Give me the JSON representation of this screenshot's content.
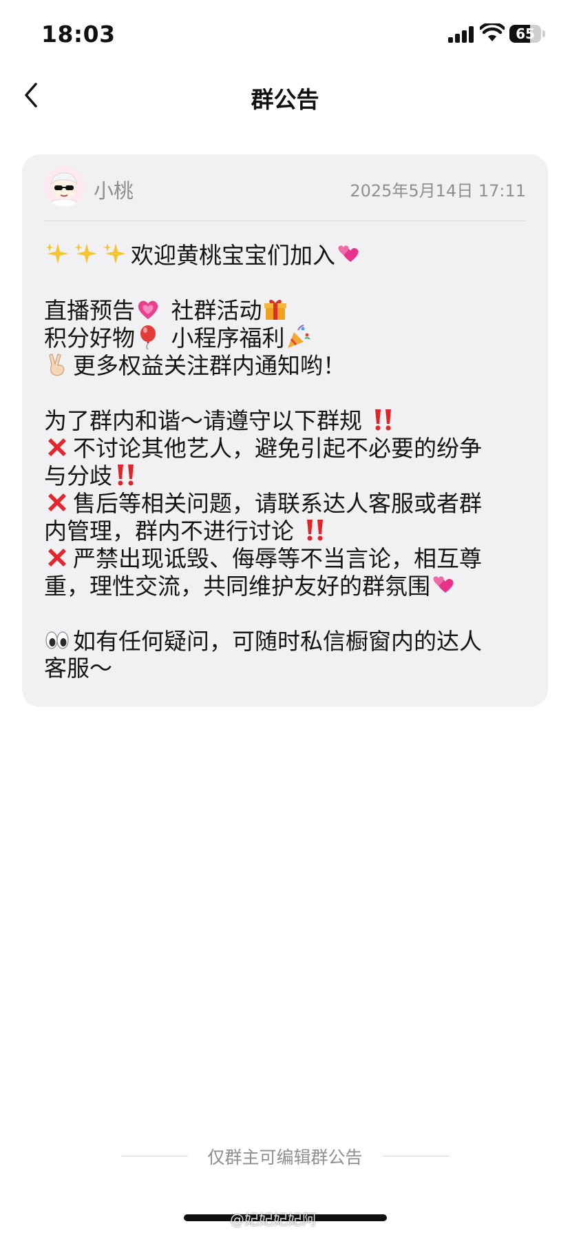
{
  "status_bar": {
    "time": "18:03",
    "battery_percent": "65",
    "battery_level": 0.65
  },
  "nav": {
    "title": "群公告"
  },
  "post": {
    "author": "小桃",
    "date": "2025年5月14日 17:11",
    "lines": [
      "欢迎黄桃宝宝们加入",
      "直播预告",
      "社群活动",
      "积分好物",
      "小程序福利",
      "更多权益关注群内通知哟！",
      "为了群内和谐～请遵守以下群规",
      "不讨论其他艺人，避免引起不必要的纷争",
      "与分歧",
      "售后等相关问题，请联系达人客服或者群",
      "内管理，群内不进行讨论",
      "严禁出现诋毁、侮辱等不当言论，相互尊",
      "重，理性交流，共同维护友好的群氛围",
      "如有任何疑问，可随时私信橱窗内的达人",
      "客服～"
    ],
    "emoji": [
      "sparkles",
      "two-hearts",
      "heart",
      "gift",
      "balloon",
      "party-popper",
      "victory-hand",
      "double-exclamation",
      "cross-mark",
      "eyes"
    ]
  },
  "footer": {
    "text": "仅群主可编辑群公告"
  },
  "watermark": "@妃妃妃妃阿"
}
